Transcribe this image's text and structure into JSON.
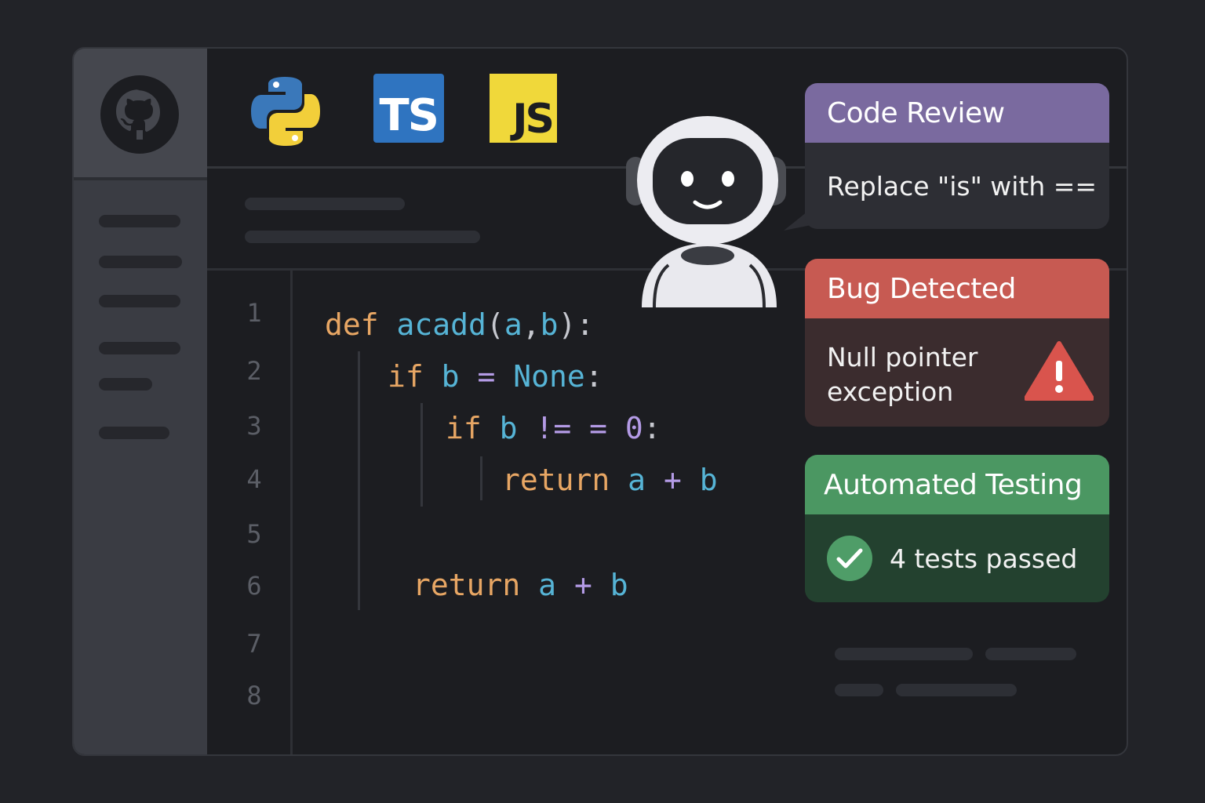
{
  "languages": {
    "ts_label": "TS",
    "js_label": "JS"
  },
  "editor": {
    "line_numbers": [
      "1",
      "2",
      "3",
      "4",
      "5",
      "6",
      "7",
      "8"
    ],
    "lines": [
      {
        "kw": "def",
        "fn": "acadd",
        "pn_open": "(",
        "a": "a",
        "comma": ",",
        "b": "b",
        "pn_close": "):"
      },
      {
        "kw": "if",
        "var": "b",
        "op": "=",
        "val": "None",
        "tail": ":"
      },
      {
        "kw": "if",
        "var": "b",
        "op": "!= =",
        "val": "0",
        "tail": ":"
      },
      {
        "kw": "return",
        "a": "a",
        "op": "+",
        "b": "b"
      },
      {
        "kw": "return",
        "a": "a",
        "op": "+",
        "b": "b"
      }
    ]
  },
  "cards": {
    "review": {
      "title": "Code Review",
      "body": "Replace \"is\" with =="
    },
    "bug": {
      "title": "Bug Detected",
      "body_line1": "Null pointer",
      "body_line2": "exception",
      "icon": "warning-icon"
    },
    "test": {
      "title": "Automated Testing",
      "body": "4 tests passed",
      "icon": "check-icon"
    }
  },
  "colors": {
    "review": "#7a6a9f",
    "bug": "#c75a52",
    "test": "#4b9762",
    "keyword": "#e7a664",
    "identifier": "#56b4d6",
    "operator": "#b49be6"
  }
}
